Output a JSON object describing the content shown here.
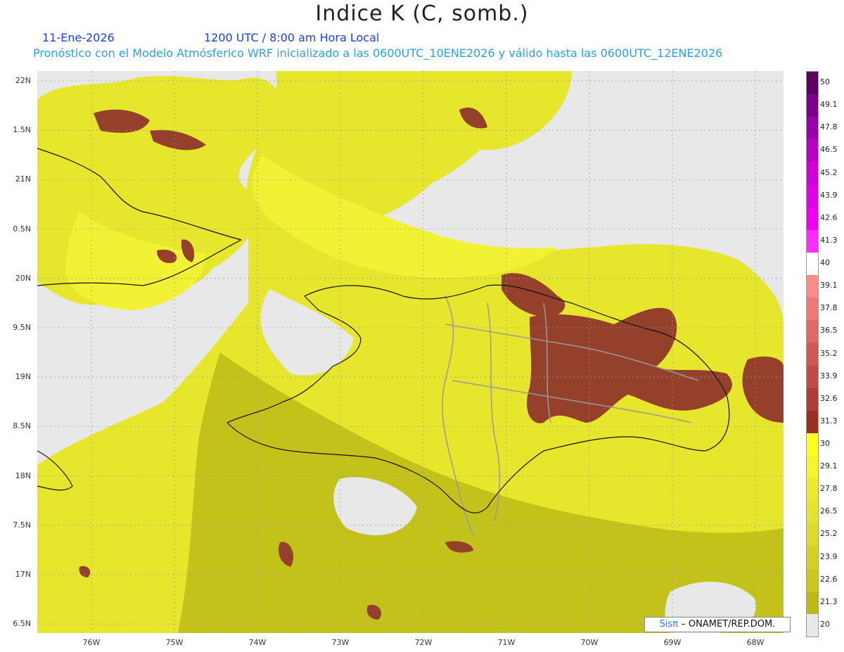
{
  "title": "Indice K (C, somb.)",
  "date": "11-Ene-2026",
  "valid_time": "1200 UTC / 8:00 am Hora Local",
  "description": "Pronóstico con el Modelo Atmósferico WRF inicializado a las 0600UTC_10ENE2026 y válido hasta las  0600UTC_12ENE2026",
  "credit": {
    "brand": "Sisπ",
    "org": "– ONAMET/REP.DOM."
  },
  "lat_labels": [
    "22N",
    "1.5N",
    "21N",
    "0.5N",
    "20N",
    "9.5N",
    "19N",
    "8.5N",
    "18N",
    "7.5N",
    "17N",
    "6.5N"
  ],
  "lon_labels": [
    "76W",
    "75W",
    "74W",
    "73W",
    "72W",
    "71W",
    "70W",
    "69W",
    "68W"
  ],
  "legend": {
    "labels": [
      "50",
      "49.1",
      "47.8",
      "46.5",
      "45.2",
      "43.9",
      "42.6",
      "41.3",
      "40",
      "39.1",
      "37.8",
      "36.5",
      "35.2",
      "33.9",
      "32.6",
      "31.3",
      "30",
      "29.1",
      "27.8",
      "26.5",
      "25.2",
      "23.9",
      "22.6",
      "21.3",
      "20"
    ],
    "colors": [
      "#5a0060",
      "#7a0088",
      "#9a00a8",
      "#b800c4",
      "#d000d8",
      "#e000e6",
      "#f000f0",
      "#ff2cff",
      "#ffffff",
      "#ff8a8a",
      "#f07878",
      "#e06868",
      "#cf5a52",
      "#bf4c44",
      "#ad3e36",
      "#9a3022",
      "#ffff20",
      "#f5f528",
      "#ecec2e",
      "#e4e42c",
      "#dcdc2a",
      "#d2d224",
      "#c8c81e",
      "#bcbc14",
      "#e8e8e8"
    ]
  },
  "map_colors": {
    "no_data": "#e8e8e8",
    "base_yellow": "#e6e62c",
    "bright_yellow": "#f2f234",
    "olive": "#c2c21a",
    "brown": "#94402a",
    "dark_brown": "#7a2f1e",
    "coast": "#111111",
    "province": "#9a9a9a"
  },
  "icons": {
    "credit_logo": "pi-symbol"
  }
}
